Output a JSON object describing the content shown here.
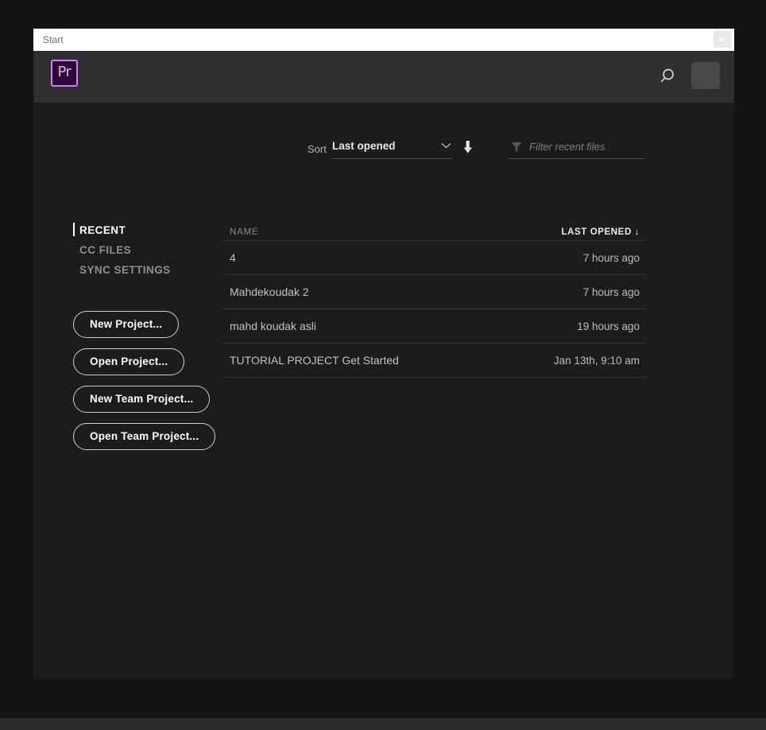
{
  "window": {
    "tab_label": "Start",
    "window_button_icon": "restore-window-icon"
  },
  "header": {
    "logo_text": "Pr",
    "logo_name": "premiere-pro-logo",
    "search_icon": "search-icon",
    "avatar_name": "user-avatar"
  },
  "toolbar": {
    "sort_label": "Sort",
    "sort_value": "Last opened",
    "sort_chevron_icon": "chevron-down-icon",
    "sort_direction_icon": "arrow-down-icon",
    "filter_icon": "funnel-icon",
    "filter_placeholder": "Filter recent files"
  },
  "sidebar": {
    "items": [
      {
        "label": "RECENT",
        "active": true
      },
      {
        "label": "CC FILES",
        "active": false
      },
      {
        "label": "SYNC SETTINGS",
        "active": false
      }
    ]
  },
  "actions": {
    "buttons": [
      {
        "label": "New Project..."
      },
      {
        "label": "Open Project..."
      },
      {
        "label": "New Team Project..."
      },
      {
        "label": "Open Team Project..."
      }
    ]
  },
  "recent_files": {
    "columns": {
      "name": "NAME",
      "last_opened": "LAST OPENED ↓"
    },
    "rows": [
      {
        "name": "4",
        "last_opened": "7 hours ago"
      },
      {
        "name": "Mahdekoudak 2",
        "last_opened": "7 hours ago"
      },
      {
        "name": "mahd koudak asli",
        "last_opened": "19 hours ago"
      },
      {
        "name": "TUTORIAL PROJECT Get Started",
        "last_opened": "Jan 13th, 9:10 am"
      }
    ]
  },
  "colors": {
    "accent_purple": "#d77aff",
    "header_bg": "#303030",
    "app_bg": "#1c1c1c",
    "page_bg": "#131313"
  }
}
